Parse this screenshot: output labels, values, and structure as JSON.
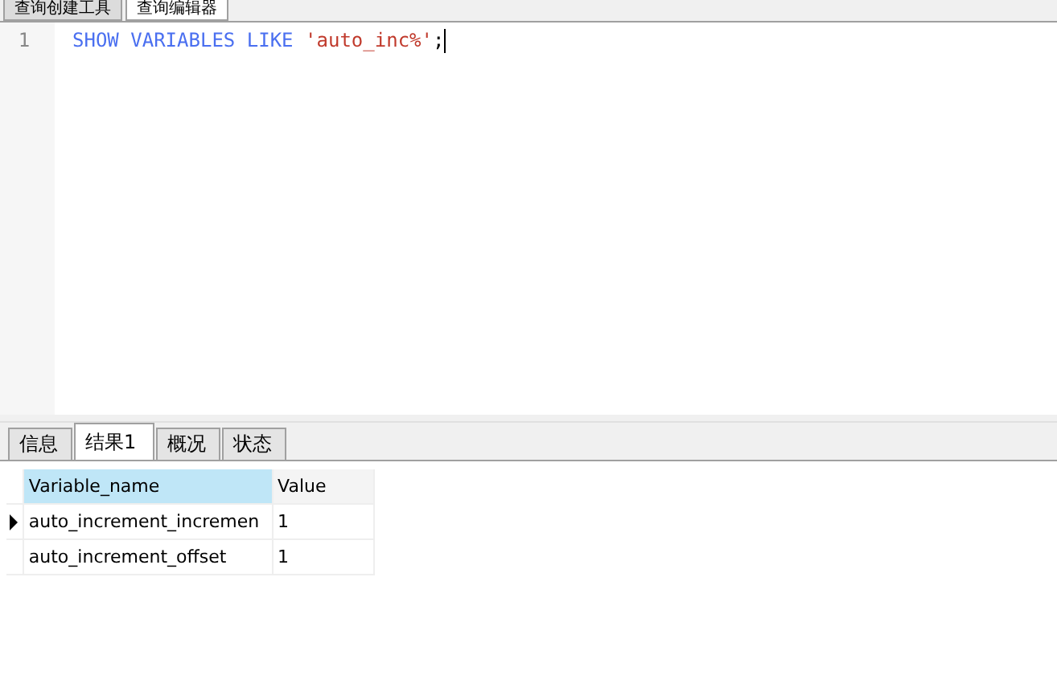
{
  "editor_tabs": [
    {
      "label": "查询创建工具",
      "selected": false
    },
    {
      "label": "查询编辑器",
      "selected": true
    }
  ],
  "editor": {
    "lines": [
      {
        "number": "1",
        "tokens": [
          {
            "kind": "keyword",
            "text": "SHOW VARIABLES LIKE"
          },
          {
            "kind": "string",
            "text": "'auto_inc%'"
          },
          {
            "kind": "plain",
            "text": ";"
          }
        ]
      }
    ]
  },
  "result_tabs": [
    {
      "label": "信息",
      "selected": false
    },
    {
      "label": "结果1",
      "selected": true
    },
    {
      "label": "概况",
      "selected": false
    },
    {
      "label": "状态",
      "selected": false
    }
  ],
  "table": {
    "columns": [
      "Variable_name",
      "Value"
    ],
    "rows": [
      {
        "cells": [
          "auto_increment_incremen",
          "1"
        ],
        "selected": true
      },
      {
        "cells": [
          "auto_increment_offset",
          "1"
        ],
        "selected": false
      }
    ]
  }
}
